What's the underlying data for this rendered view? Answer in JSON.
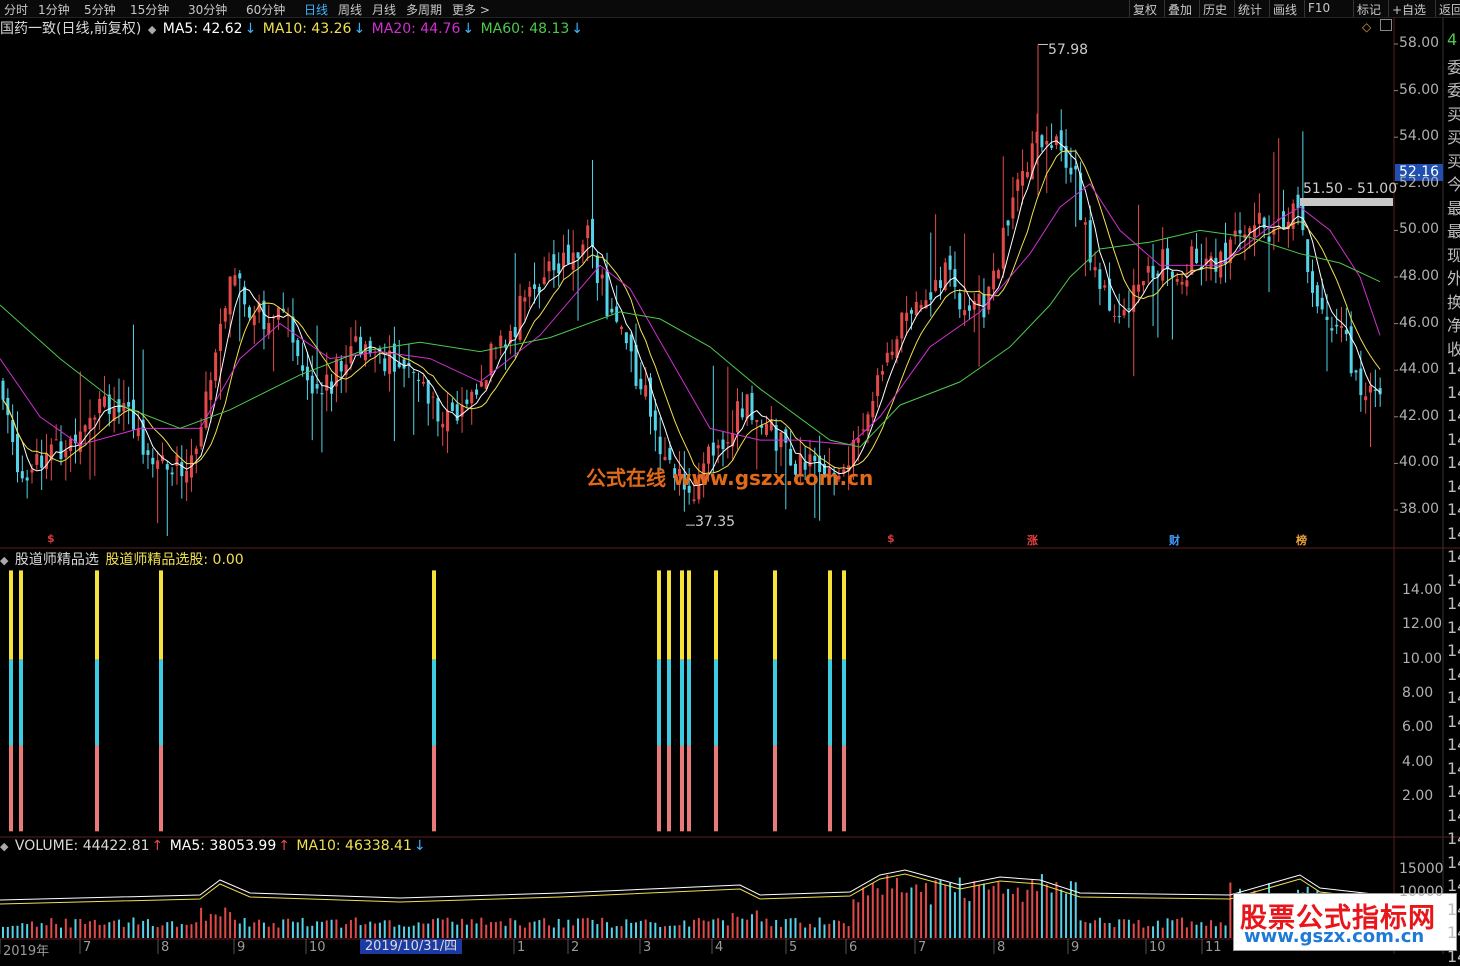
{
  "toolbar": {
    "left_items": [
      "分时",
      "1分钟",
      "5分钟",
      "15分钟",
      "30分钟",
      "60分钟",
      "日线",
      "周线",
      "月线",
      "多周期",
      "更多 >"
    ],
    "active_item": "日线",
    "right_items": [
      "复权",
      "叠加",
      "历史",
      "统计",
      "画线",
      "F10",
      "标记",
      "+自选",
      "返回"
    ]
  },
  "main_pane": {
    "title": "国药一致(日线,前复权)",
    "ma5_label": "MA5: 42.62",
    "ma10_label": "MA10: 43.26",
    "ma20_label": "MA20: 44.76",
    "ma60_label": "MA60: 48.13",
    "down_arrow": "↓",
    "high_label": "57.98",
    "low_label": "37.35",
    "range_label": "51.50 - 51.00",
    "current_price": "52.16",
    "y_axis": [
      "58.00",
      "56.00",
      "54.00",
      "52.00",
      "50.00",
      "48.00",
      "46.00",
      "44.00",
      "42.00",
      "40.00",
      "38.00"
    ],
    "signal_labels": [
      {
        "text": "$",
        "color": "#d23c3c"
      },
      {
        "text": "$",
        "color": "#d23c3c"
      },
      {
        "text": "涨",
        "color": "#e04040"
      },
      {
        "text": "财",
        "color": "#3f9bff"
      },
      {
        "text": "榜",
        "color": "#e8a33a"
      }
    ],
    "watermark": "公式在线 www.gszx.com.cn"
  },
  "indicator_pane": {
    "title": "股道师精品选",
    "value_label": "股道师精品选股: 0.00",
    "y_axis": [
      "14.00",
      "12.00",
      "10.00",
      "8.00",
      "6.00",
      "4.00",
      "2.00"
    ]
  },
  "volume_pane": {
    "volume_label": "VOLUME: 44422.81",
    "ma5_label": "MA5: 38053.99",
    "ma10_label": "MA10: 46338.41",
    "up_arrow": "↑",
    "down_arrow": "↓",
    "y_axis": [
      "15000",
      "10000"
    ]
  },
  "date_axis": {
    "labels": [
      "2019年",
      "7",
      "8",
      "9",
      "10",
      "1",
      "2",
      "3",
      "4",
      "5",
      "6",
      "7",
      "8",
      "9",
      "10",
      "11"
    ],
    "highlight": "2019/10/31/四"
  },
  "right_panel_glyphs": [
    "4",
    "委",
    "委",
    "买",
    "买",
    "买",
    "今",
    "最",
    "最",
    "现",
    "外",
    "换",
    "净",
    "收",
    "14",
    "14",
    "14",
    "14",
    "14",
    "14",
    "14",
    "14",
    "14",
    "14",
    "14",
    "14",
    "14",
    "14",
    "14",
    "14",
    "14",
    "14",
    "14",
    "14",
    "14",
    "14",
    "14",
    "14",
    "14",
    "14"
  ],
  "brand_watermark": {
    "line1": "股票公式指标网",
    "line2": "www.gszx.com.cn"
  },
  "colors": {
    "up": "#e24a4a",
    "down": "#54d2e8",
    "ma5": "#ffffff",
    "ma10": "#f0e050",
    "ma20": "#d030d0",
    "ma60": "#4cc84c",
    "bar_top": "#f5e23a",
    "bar_mid": "#3ccbe0",
    "bar_bot": "#e87a7a"
  },
  "chart_data": {
    "type": "candlestick",
    "y_range_price": [
      37.0,
      59.0
    ],
    "close_trend": [
      [
        0,
        43.5
      ],
      [
        8,
        41.5
      ],
      [
        16,
        40.5
      ],
      [
        24,
        39.2
      ],
      [
        34,
        40.6
      ],
      [
        44,
        40.4
      ],
      [
        54,
        40.5
      ],
      [
        62,
        40.6
      ],
      [
        72,
        41.0
      ],
      [
        82,
        42.0
      ],
      [
        94,
        42.5
      ],
      [
        104,
        43.1
      ],
      [
        114,
        42.5
      ],
      [
        124,
        42.0
      ],
      [
        134,
        41.5
      ],
      [
        144,
        41.0
      ],
      [
        156,
        40.2
      ],
      [
        166,
        39.9
      ],
      [
        176,
        39.8
      ],
      [
        186,
        39.9
      ],
      [
        196,
        40.5
      ],
      [
        206,
        42.5
      ],
      [
        216,
        45.5
      ],
      [
        226,
        47.5
      ],
      [
        236,
        47.5
      ],
      [
        246,
        47.0
      ],
      [
        256,
        46.5
      ],
      [
        266,
        46.0
      ],
      [
        276,
        46.5
      ],
      [
        286,
        46.0
      ],
      [
        296,
        45.0
      ],
      [
        306,
        44.0
      ],
      [
        316,
        43.5
      ],
      [
        326,
        43.5
      ],
      [
        336,
        43.8
      ],
      [
        346,
        44.5
      ],
      [
        356,
        45.0
      ],
      [
        366,
        45.5
      ],
      [
        376,
        45.0
      ],
      [
        386,
        44.5
      ],
      [
        396,
        44.0
      ],
      [
        406,
        43.8
      ],
      [
        416,
        43.5
      ],
      [
        426,
        43.0
      ],
      [
        436,
        42.5
      ],
      [
        446,
        42.0
      ],
      [
        456,
        42.0
      ],
      [
        466,
        42.5
      ],
      [
        476,
        43.0
      ],
      [
        486,
        44.0
      ],
      [
        496,
        45.0
      ],
      [
        506,
        45.5
      ],
      [
        516,
        46.0
      ],
      [
        526,
        47.5
      ],
      [
        536,
        48.0
      ],
      [
        546,
        48.0
      ],
      [
        556,
        48.5
      ],
      [
        566,
        48.5
      ],
      [
        576,
        49.0
      ],
      [
        586,
        50.5
      ],
      [
        596,
        48.5
      ],
      [
        606,
        47.0
      ],
      [
        616,
        46.0
      ],
      [
        626,
        45.5
      ],
      [
        636,
        44.0
      ],
      [
        646,
        43.0
      ],
      [
        656,
        41.5
      ],
      [
        666,
        40.5
      ],
      [
        676,
        39.5
      ],
      [
        686,
        38.5
      ],
      [
        696,
        39.0
      ],
      [
        706,
        40.0
      ],
      [
        716,
        40.5
      ],
      [
        726,
        41.5
      ],
      [
        736,
        42.0
      ],
      [
        746,
        42.5
      ],
      [
        756,
        42.0
      ],
      [
        766,
        41.5
      ],
      [
        776,
        41.0
      ],
      [
        786,
        40.5
      ],
      [
        796,
        40.2
      ],
      [
        806,
        40.0
      ],
      [
        816,
        39.8
      ],
      [
        826,
        39.6
      ],
      [
        836,
        39.5
      ],
      [
        846,
        39.8
      ],
      [
        856,
        40.5
      ],
      [
        866,
        42.0
      ],
      [
        876,
        43.5
      ],
      [
        886,
        44.5
      ],
      [
        896,
        45.5
      ],
      [
        906,
        46.0
      ],
      [
        916,
        46.5
      ],
      [
        926,
        47.0
      ],
      [
        936,
        47.5
      ],
      [
        946,
        48.0
      ],
      [
        956,
        47.5
      ],
      [
        966,
        47.0
      ],
      [
        976,
        46.5
      ],
      [
        986,
        47.0
      ],
      [
        996,
        48.5
      ],
      [
        1006,
        50.0
      ],
      [
        1016,
        51.5
      ],
      [
        1026,
        52.5
      ],
      [
        1036,
        53.5
      ],
      [
        1046,
        54.0
      ],
      [
        1056,
        53.5
      ],
      [
        1066,
        53.0
      ],
      [
        1076,
        52.0
      ],
      [
        1086,
        50.0
      ],
      [
        1096,
        48.0
      ],
      [
        1106,
        47.0
      ],
      [
        1116,
        47.0
      ],
      [
        1126,
        46.5
      ],
      [
        1136,
        47.5
      ],
      [
        1146,
        48.0
      ],
      [
        1156,
        48.5
      ],
      [
        1166,
        48.5
      ],
      [
        1176,
        48.0
      ],
      [
        1186,
        48.5
      ],
      [
        1196,
        49.0
      ],
      [
        1206,
        49.0
      ],
      [
        1216,
        48.5
      ],
      [
        1226,
        49.0
      ],
      [
        1236,
        49.5
      ],
      [
        1246,
        50.0
      ],
      [
        1256,
        50.5
      ],
      [
        1266,
        50.0
      ],
      [
        1276,
        50.5
      ],
      [
        1286,
        50.8
      ],
      [
        1296,
        51.2
      ],
      [
        1306,
        49.0
      ],
      [
        1316,
        47.0
      ],
      [
        1326,
        46.0
      ],
      [
        1336,
        45.5
      ],
      [
        1346,
        45.0
      ],
      [
        1356,
        44.0
      ],
      [
        1366,
        43.0
      ],
      [
        1376,
        42.5
      ],
      [
        1382,
        42.8
      ]
    ],
    "ma60_trend": [
      [
        0,
        46.8
      ],
      [
        60,
        44.5
      ],
      [
        120,
        42.5
      ],
      [
        180,
        41.5
      ],
      [
        230,
        42.3
      ],
      [
        300,
        43.8
      ],
      [
        360,
        44.8
      ],
      [
        420,
        45.2
      ],
      [
        480,
        44.8
      ],
      [
        550,
        45.4
      ],
      [
        620,
        46.5
      ],
      [
        660,
        46.2
      ],
      [
        710,
        45.0
      ],
      [
        760,
        43.2
      ],
      [
        830,
        41.0
      ],
      [
        860,
        40.7
      ],
      [
        900,
        42.5
      ],
      [
        960,
        43.5
      ],
      [
        1010,
        45.0
      ],
      [
        1050,
        46.8
      ],
      [
        1070,
        48.0
      ],
      [
        1100,
        49.2
      ],
      [
        1150,
        49.5
      ],
      [
        1200,
        50.0
      ],
      [
        1250,
        49.7
      ],
      [
        1300,
        49.0
      ],
      [
        1340,
        48.6
      ],
      [
        1380,
        47.8
      ]
    ],
    "ma20_trend": [
      [
        0,
        44.5
      ],
      [
        40,
        42.0
      ],
      [
        80,
        40.8
      ],
      [
        140,
        41.5
      ],
      [
        200,
        41.5
      ],
      [
        240,
        44.5
      ],
      [
        280,
        46.0
      ],
      [
        330,
        44.5
      ],
      [
        380,
        44.8
      ],
      [
        430,
        44.5
      ],
      [
        480,
        43.5
      ],
      [
        540,
        45.5
      ],
      [
        600,
        48.5
      ],
      [
        630,
        47.5
      ],
      [
        670,
        44.5
      ],
      [
        710,
        41.5
      ],
      [
        760,
        41.0
      ],
      [
        800,
        41.0
      ],
      [
        850,
        40.8
      ],
      [
        880,
        42.0
      ],
      [
        930,
        45.0
      ],
      [
        980,
        46.5
      ],
      [
        1030,
        49.0
      ],
      [
        1060,
        51.0
      ],
      [
        1090,
        52.0
      ],
      [
        1120,
        50.0
      ],
      [
        1160,
        48.5
      ],
      [
        1220,
        48.5
      ],
      [
        1280,
        50.5
      ],
      [
        1300,
        51.0
      ],
      [
        1330,
        50.0
      ],
      [
        1360,
        48.0
      ],
      [
        1380,
        45.5
      ]
    ],
    "indicator_bars_x": [
      11,
      21,
      97,
      161,
      434,
      659,
      669,
      682,
      689,
      716,
      775,
      830,
      844
    ],
    "indicator_segments": {
      "top_range": [
        10,
        15.2
      ],
      "mid_range": [
        5,
        10
      ],
      "bot_range": [
        0,
        5
      ]
    }
  }
}
